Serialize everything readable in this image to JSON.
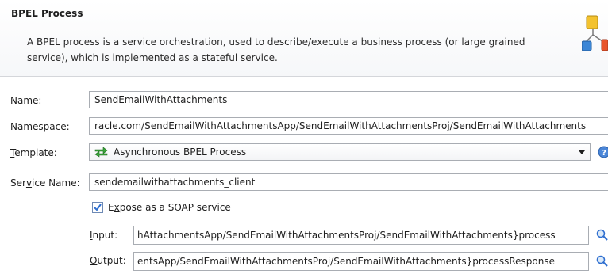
{
  "header": {
    "title": "BPEL Process",
    "description": "A BPEL process is a service orchestration, used to describe/execute a business process (or large grained service), which is implemented as a stateful service."
  },
  "form": {
    "name": {
      "label_mnemonic": "N",
      "label_rest": "ame:",
      "value": "SendEmailWithAttachments"
    },
    "namespace": {
      "label_pre": "Name",
      "label_mnemonic": "s",
      "label_post": "pace:",
      "value": "racle.com/SendEmailWithAttachmentsApp/SendEmailWithAttachmentsProj/SendEmailWithAttachments"
    },
    "template": {
      "label_mnemonic": "T",
      "label_rest": "emplate:",
      "value": "Asynchronous BPEL Process"
    },
    "service_name": {
      "label_pre": "Ser",
      "label_mnemonic": "v",
      "label_post": "ice Name:",
      "value": "sendemailwithattachments_client"
    },
    "expose_soap": {
      "label_pre": "E",
      "label_mnemonic": "x",
      "label_post": "pose as a SOAP service",
      "checked": true
    },
    "input": {
      "label_mnemonic": "I",
      "label_rest": "nput:",
      "value": "hAttachmentsApp/SendEmailWithAttachmentsProj/SendEmailWithAttachments}process"
    },
    "output": {
      "label_mnemonic": "O",
      "label_rest": "utput:",
      "value": "entsApp/SendEmailWithAttachmentsProj/SendEmailWithAttachments}processResponse"
    }
  },
  "icons": {
    "header": "bpel-process-icon",
    "template": "async-process-icon",
    "dropdown": "chevron-down-icon",
    "help": "help-icon",
    "search": "search-icon"
  },
  "colors": {
    "accent": "#2f6fd0",
    "field_border": "#a9adb3",
    "header_bg": "#f6f7f9"
  }
}
